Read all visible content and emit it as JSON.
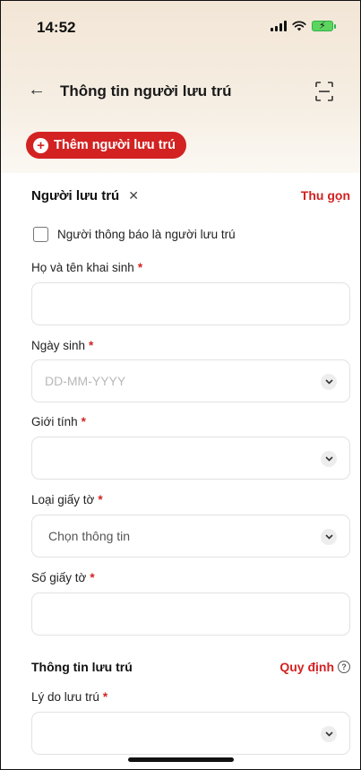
{
  "status": {
    "time": "14:52"
  },
  "header": {
    "title": "Thông tin người lưu trú"
  },
  "add_button": {
    "label": "Thêm người lưu trú"
  },
  "section1": {
    "title": "Người lưu trú",
    "collapse_label": "Thu gọn"
  },
  "checkbox": {
    "label": "Người thông báo là người lưu trú"
  },
  "fields": {
    "full_name": {
      "label": "Họ và tên khai sinh"
    },
    "dob": {
      "label": "Ngày sinh",
      "placeholder": "DD-MM-YYYY"
    },
    "gender": {
      "label": "Giới tính"
    },
    "doc_type": {
      "label": "Loại giấy tờ",
      "value": "Chọn thông tin"
    },
    "doc_number": {
      "label": "Số giấy tờ"
    },
    "reason": {
      "label": "Lý do lưu trú"
    }
  },
  "section2": {
    "title": "Thông tin lưu trú",
    "link_label": "Quy định"
  },
  "required_mark": "*",
  "colors": {
    "accent": "#d32222",
    "band": "#f2e6d6"
  }
}
